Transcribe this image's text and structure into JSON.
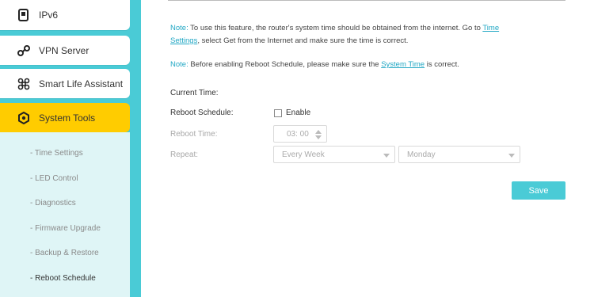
{
  "sidebar": {
    "items": [
      {
        "label": "IPv6",
        "icon": "document-icon"
      },
      {
        "label": "VPN Server",
        "icon": "link-icon"
      },
      {
        "label": "Smart Life Assistant",
        "icon": "command-icon"
      },
      {
        "label": "System Tools",
        "icon": "gear-icon"
      }
    ],
    "sub_items": [
      "- Time Settings",
      "- LED Control",
      "- Diagnostics",
      "- Firmware Upgrade",
      "- Backup & Restore",
      "- Reboot Schedule"
    ]
  },
  "notes": {
    "note1": {
      "tag": "Note:",
      "text1": " To use this feature, the router's system time should be obtained from the internet. Go to ",
      "link1": "Time",
      "link2": "Settings",
      "text2": ", select Get from the Internet and make sure the time is correct."
    },
    "note2": {
      "tag": "Note:",
      "text1": " Before enabling Reboot Schedule, please make sure the ",
      "link": "System Time",
      "text2": " is correct."
    }
  },
  "form": {
    "current_time_label": "Current Time:",
    "reboot_schedule_label": "Reboot Schedule:",
    "enable_label": "Enable",
    "reboot_time_label": "Reboot Time:",
    "reboot_time_value": "03: 00",
    "repeat_label": "Repeat:",
    "repeat_value": "Every Week",
    "day_value": "Monday",
    "save_label": "Save"
  },
  "colors": {
    "accent": "#4acbd6",
    "active": "#ffcc00",
    "link": "#21a7c4"
  }
}
